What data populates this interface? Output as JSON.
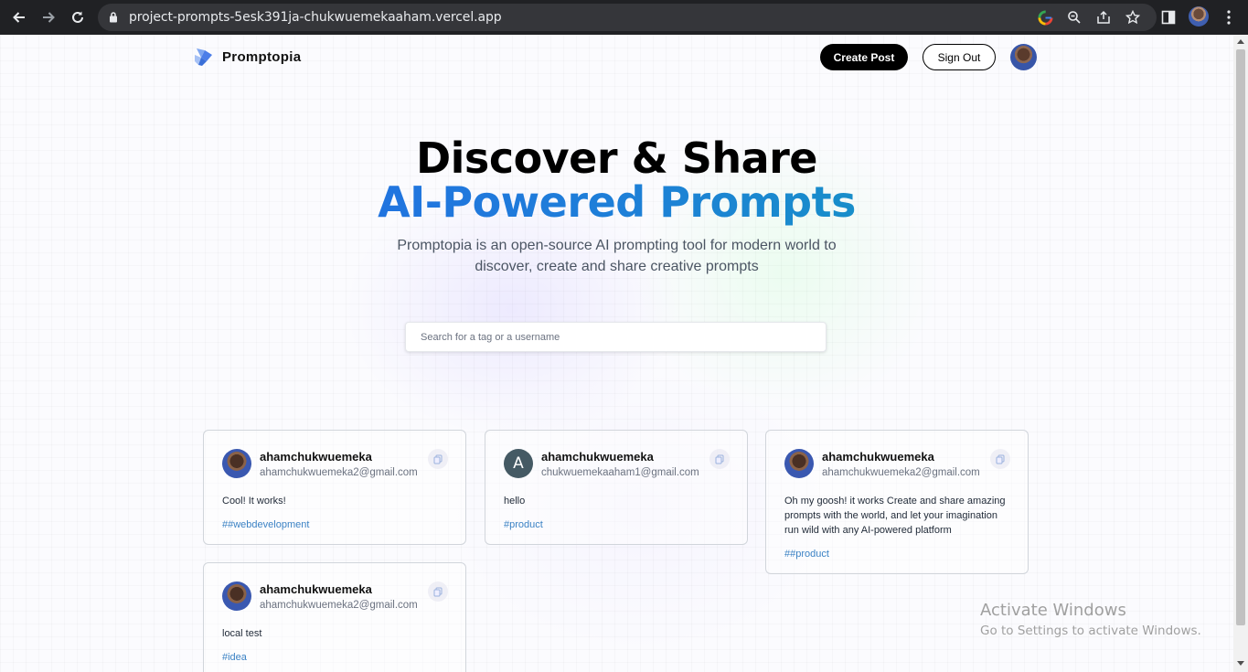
{
  "browser": {
    "url": "project-prompts-5esk391ja-chukwuemekaaham.vercel.app"
  },
  "nav": {
    "logo_text": "Promptopia",
    "create_post": "Create Post",
    "sign_out": "Sign Out"
  },
  "hero": {
    "title_line1": "Discover & Share",
    "title_line2": "AI-Powered Prompts",
    "description": "Promptopia is an open-source AI prompting tool for modern world to discover, create and share creative prompts"
  },
  "search": {
    "placeholder": "Search for a tag or a username"
  },
  "prompts": [
    {
      "username": "ahamchukwuemeka",
      "email": "ahamchukwuemeka2@gmail.com",
      "text": "Cool! It works!",
      "tag": "##webdevelopment"
    },
    {
      "username": "ahamchukwuemeka",
      "email": "chukwuemekaaham1@gmail.com",
      "text": "hello",
      "tag": "#product",
      "avatar_letter": "A"
    },
    {
      "username": "ahamchukwuemeka",
      "email": "ahamchukwuemeka2@gmail.com",
      "text": "Oh my goosh! it works Create and share amazing prompts with the world, and let your imagination run wild with any AI-powered platform",
      "tag": "##product"
    },
    {
      "username": "ahamchukwuemeka",
      "email": "ahamchukwuemeka2@gmail.com",
      "text": "local test",
      "tag": "#idea"
    }
  ],
  "watermark": {
    "line1": "Activate Windows",
    "line2": "Go to Settings to activate Windows."
  },
  "colors": {
    "gradient_start": "#2563eb",
    "gradient_end": "#0ea5b4",
    "tag": "#3b82c4"
  }
}
